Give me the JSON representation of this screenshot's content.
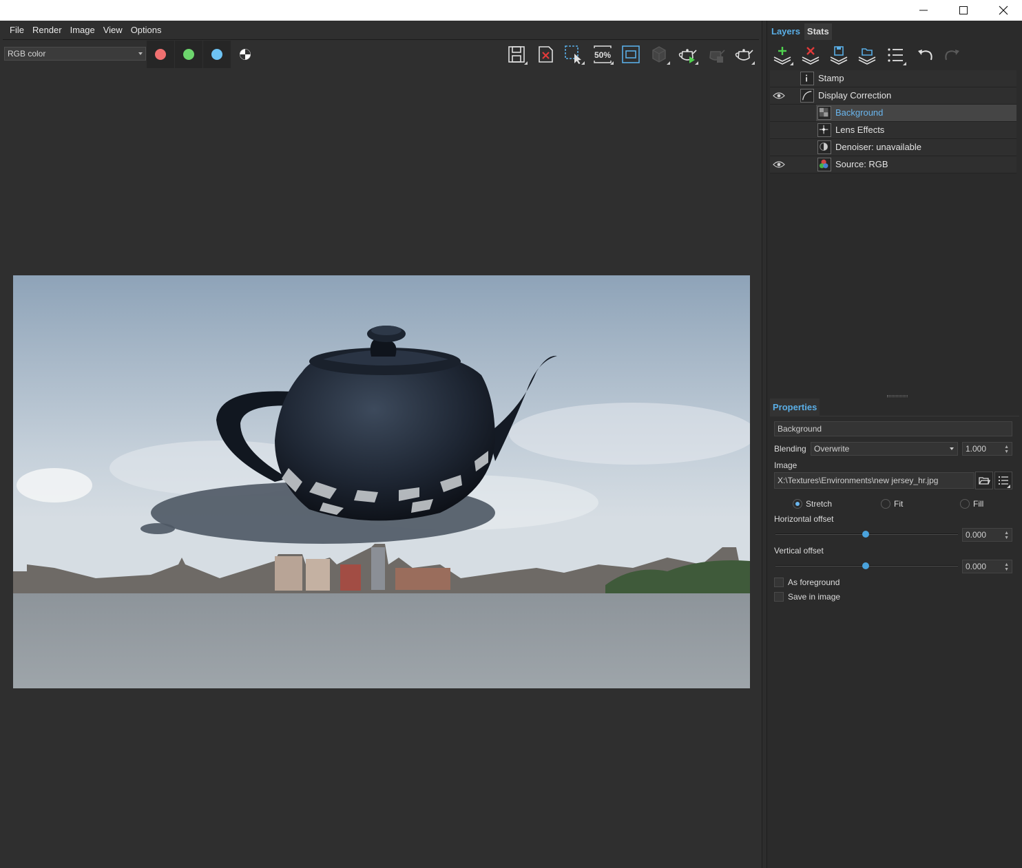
{
  "menu": [
    "File",
    "Render",
    "Image",
    "View",
    "Options"
  ],
  "toolbar": {
    "channel_select": "RGB color",
    "swatches": [
      {
        "name": "red-channel",
        "color": "#f07070"
      },
      {
        "name": "green-channel",
        "color": "#6dd56d"
      },
      {
        "name": "blue-channel",
        "color": "#6ec3f4"
      }
    ],
    "zoom_label": "50%"
  },
  "right_panel": {
    "tabs": [
      "Layers",
      "Stats"
    ],
    "active_tab": "Layers",
    "layers": [
      {
        "label": "Stamp",
        "icon": "info-icon",
        "visible_eye": false,
        "indent": 1,
        "selected": false
      },
      {
        "label": "Display Correction",
        "icon": "curve-icon",
        "visible_eye": true,
        "indent": 1,
        "selected": false
      },
      {
        "label": "Background",
        "icon": "checker-icon",
        "visible_eye": false,
        "indent": 2,
        "selected": true
      },
      {
        "label": "Lens Effects",
        "icon": "lens-star-icon",
        "visible_eye": false,
        "indent": 2,
        "selected": false
      },
      {
        "label": "Denoiser: unavailable",
        "icon": "denoiser-icon",
        "visible_eye": false,
        "indent": 2,
        "selected": false
      },
      {
        "label": "Source: RGB",
        "icon": "rgb-source-icon",
        "visible_eye": true,
        "indent": 2,
        "selected": false
      }
    ]
  },
  "properties": {
    "title": "Properties",
    "layer_name": "Background",
    "blending_label": "Blending",
    "blending_mode": "Overwrite",
    "blending_amount": "1.000",
    "image_label": "Image",
    "image_path": "X:\\Textures\\Environments\\new jersey_hr.jpg",
    "fit_options": [
      "Stretch",
      "Fit",
      "Fill"
    ],
    "fit_selected": "Stretch",
    "horizontal_offset_label": "Horizontal offset",
    "horizontal_offset": "0.000",
    "vertical_offset_label": "Vertical offset",
    "vertical_offset": "0.000",
    "as_foreground_label": "As foreground",
    "as_foreground": false,
    "save_in_image_label": "Save in image",
    "save_in_image": false
  },
  "colors": {
    "accent": "#5aaee6",
    "panel_bg": "#2b2b2b"
  }
}
